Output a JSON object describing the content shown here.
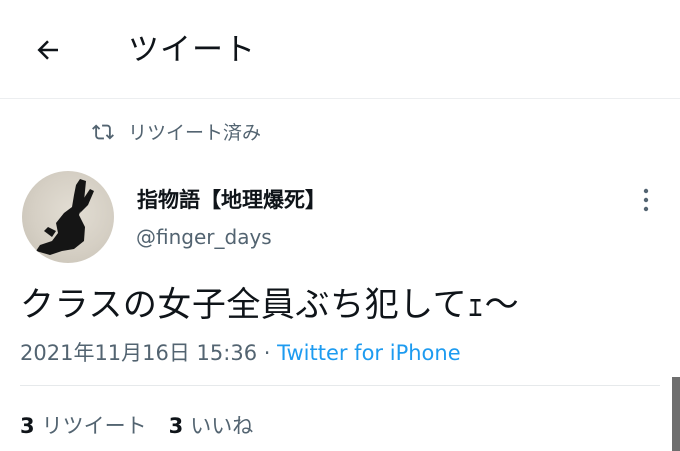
{
  "header": {
    "title": "ツイート",
    "back_icon": "arrow-left-icon"
  },
  "retweet_banner": {
    "icon": "retweet-icon",
    "text": "リツイート済み"
  },
  "author": {
    "display_name": "指物語【地理爆死】",
    "username": "@finger_days",
    "more_icon": "more-vertical-icon"
  },
  "tweet": {
    "text": "クラスの女子全員ぶち犯してｪ〜",
    "timestamp": "2021年11月16日 15:36",
    "separator": " · ",
    "source": "Twitter for iPhone"
  },
  "stats": [
    {
      "count": "3",
      "label": "リツイート"
    },
    {
      "count": "3",
      "label": "いいね"
    }
  ],
  "colors": {
    "text_primary": "#0f1419",
    "text_secondary": "#536471",
    "link": "#1d9bf0",
    "divider": "#e6e9eb"
  }
}
